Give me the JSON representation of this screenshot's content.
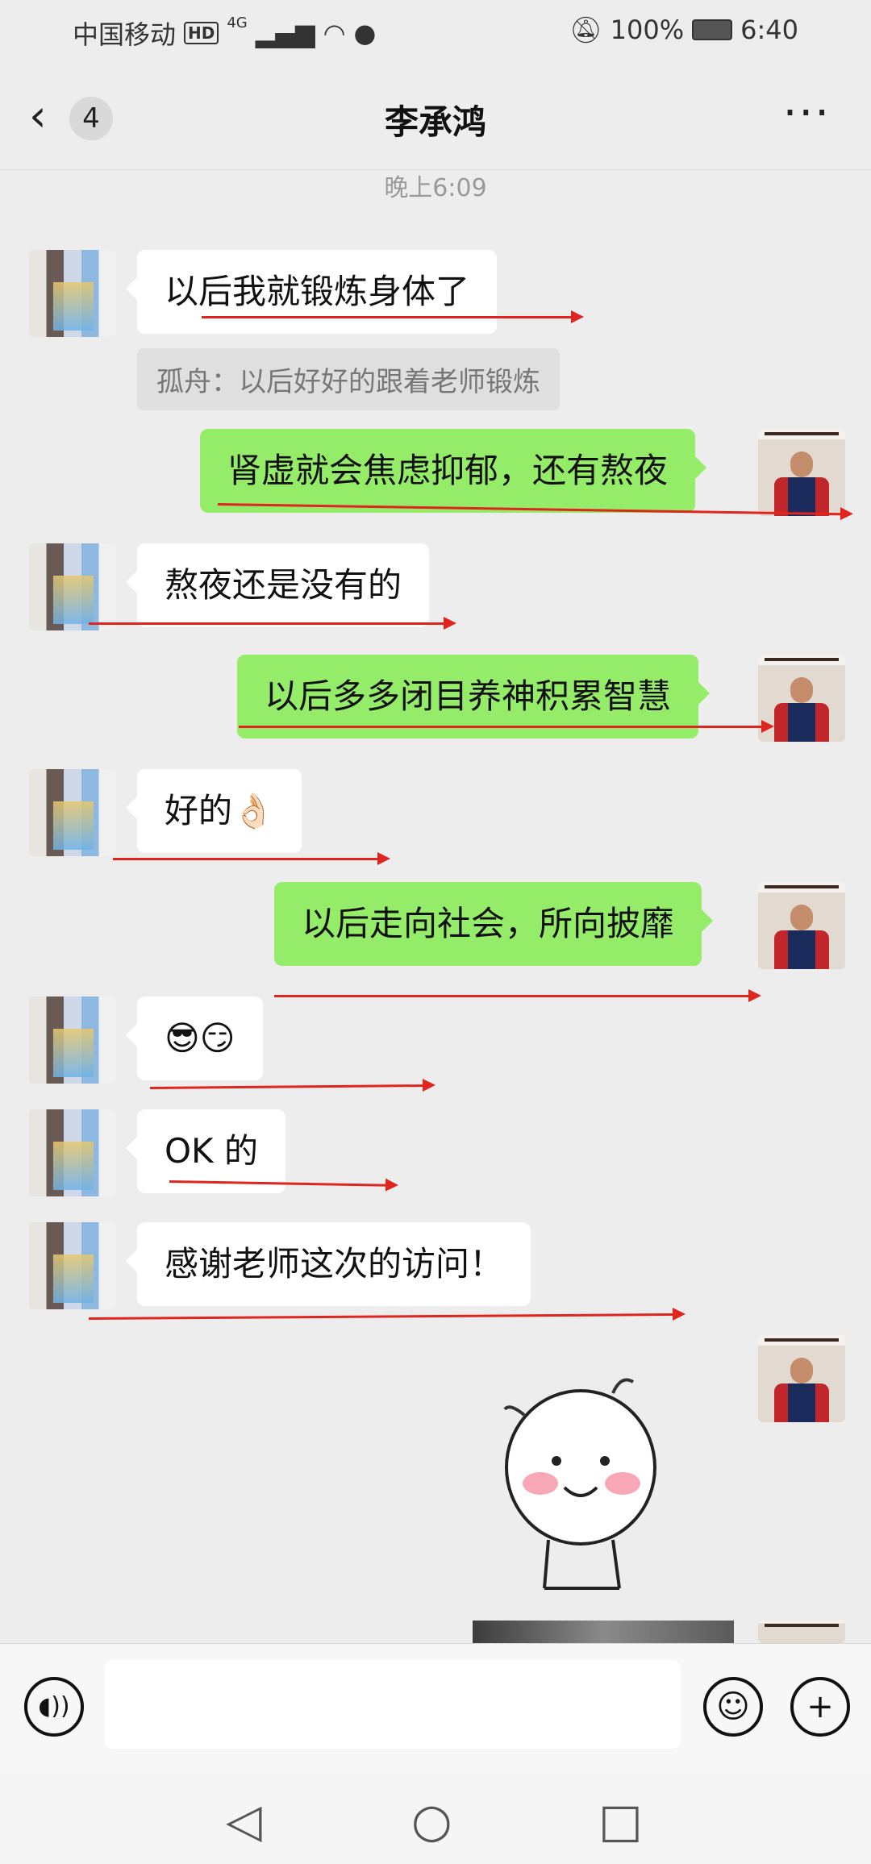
{
  "status_bar": {
    "carrier": "中国移动",
    "hd": "HD",
    "network": "4G",
    "battery": "100%",
    "time": "6:40"
  },
  "nav": {
    "back_icon": "chevron-left-icon",
    "unread_count": "4",
    "title": "李承鸿",
    "more": "···"
  },
  "timestamp": "晚上6:09",
  "messages": [
    {
      "side": "left",
      "text": "以后我就锻炼身体了"
    },
    {
      "side": "quote",
      "text": "孤舟：以后好好的跟着老师锻炼"
    },
    {
      "side": "right",
      "text": "肾虚就会焦虑抑郁，还有熬夜"
    },
    {
      "side": "left",
      "text": "熬夜还是没有的"
    },
    {
      "side": "right",
      "text": "以后多多闭目养神积累智慧"
    },
    {
      "side": "left",
      "text": "好的👌🏻"
    },
    {
      "side": "right",
      "text": "以后走向社会，所向披靡"
    },
    {
      "side": "left",
      "text": "😎😏"
    },
    {
      "side": "left",
      "text": "OK 的"
    },
    {
      "side": "left",
      "text": "感谢老师这次的访问！"
    }
  ],
  "input": {
    "placeholder": ""
  },
  "icons": {
    "voice": "voice-icon",
    "emoji": "emoji-icon",
    "plus": "plus-icon",
    "back": "triangle-back-icon",
    "home": "circle-home-icon",
    "recents": "square-recents-icon"
  },
  "colors": {
    "chat_bg": "#ededed",
    "sent_bubble": "#95ec69",
    "received_bubble": "#ffffff",
    "annotation_red": "#e0241e"
  }
}
